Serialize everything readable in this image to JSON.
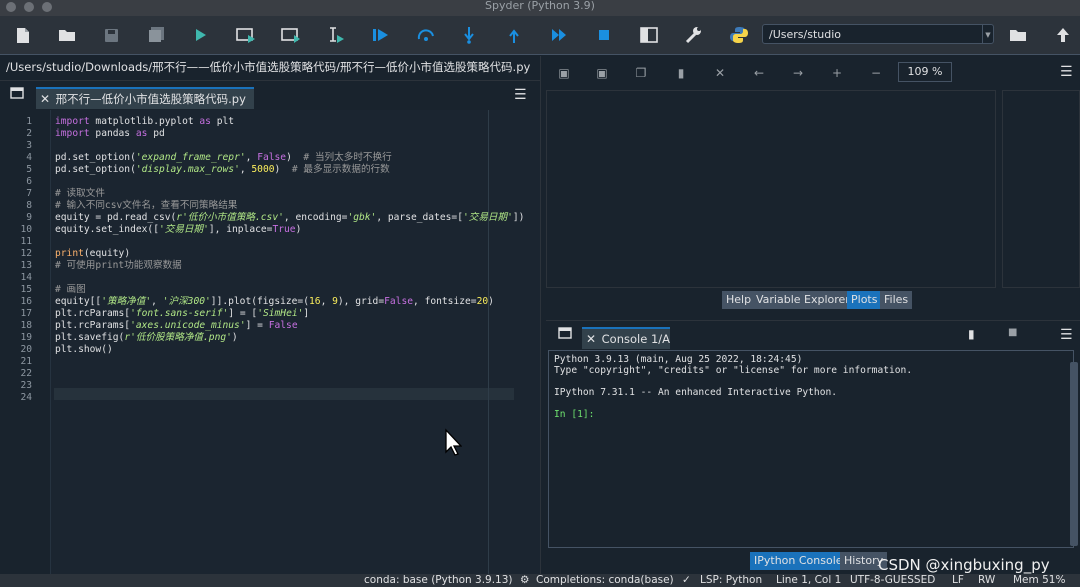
{
  "window": {
    "title": "Spyder (Python 3.9)"
  },
  "toolbar": {
    "icons": [
      "new-file-icon",
      "open-folder-icon",
      "save-icon",
      "save-all-icon",
      "run-icon",
      "run-cell-icon",
      "run-cell-advance-icon",
      "run-selection-icon",
      "debug-icon",
      "step-icon",
      "step-into-icon",
      "step-return-icon",
      "continue-icon",
      "stop-icon",
      "maximize-pane-icon",
      "preferences-icon",
      "python-path-icon"
    ],
    "working_dir": "/Users/studio"
  },
  "editor": {
    "file_path": "/Users/studio/Downloads/邢不行——低价小市值选股策略代码/邢不行—低价小市值选股策略代码.py",
    "tab_label": "邢不行—低价小市值选股策略代码.py",
    "line_numbers": [
      "1",
      "2",
      "3",
      "4",
      "5",
      "6",
      "7",
      "8",
      "9",
      "10",
      "11",
      "12",
      "13",
      "14",
      "15",
      "16",
      "17",
      "18",
      "19",
      "20",
      "21",
      "22",
      "23",
      "24"
    ]
  },
  "plots": {
    "zoom": "109 %"
  },
  "pane_tabs": {
    "help": "Help",
    "variable_explorer": "Variable Explorer",
    "plots": "Plots",
    "files": "Files"
  },
  "console": {
    "tab_label": "Console 1/A",
    "lines": [
      "Python 3.9.13 (main, Aug 25 2022, 18:24:45)",
      "Type \"copyright\", \"credits\" or \"license\" for more information.",
      "",
      "IPython 7.31.1 -- An enhanced Interactive Python.",
      "",
      "In [1]:"
    ],
    "bottom_tabs": {
      "ipython": "IPython Console",
      "history": "History"
    }
  },
  "statusbar": {
    "env": "conda: base (Python 3.9.13)",
    "completions": "Completions: conda(base)",
    "lsp": "LSP: Python",
    "position": "Line 1, Col 1",
    "encoding": "UTF-8-GUESSED",
    "eol": "LF",
    "permissions": "RW",
    "memory": "Mem 51%"
  },
  "watermark": "CSDN @xingbuxing_py",
  "colors": {
    "accent": "#1a72bb",
    "background": "#19232d",
    "keyword": "#c670e0",
    "string": "#b0e686",
    "number": "#faed5c"
  }
}
